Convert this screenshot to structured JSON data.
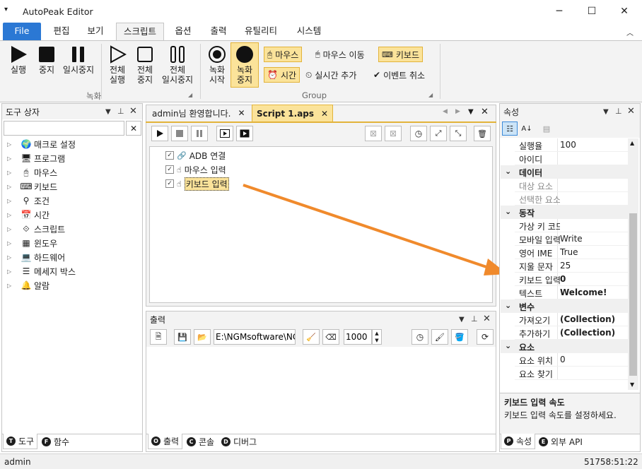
{
  "window": {
    "title": "AutoPeak Editor",
    "minimize_glyph": "─",
    "maximize_glyph": "☐",
    "close_glyph": "✕"
  },
  "ribbon_tabs": [
    "File",
    "편집",
    "보기",
    "스크립트",
    "옵션",
    "출력",
    "유틸리티",
    "시스템"
  ],
  "ribbon": {
    "record_group": {
      "label": "녹화",
      "run": "실행",
      "stop": "중지",
      "pause": "일시중지",
      "run_all_1": "전체",
      "run_all_2": "실행",
      "stop_all_1": "전체",
      "stop_all_2": "중지",
      "pause_all_1": "전체",
      "pause_all_2": "일시중지"
    },
    "group": {
      "label": "Group",
      "rec_start_1": "녹화",
      "rec_start_2": "시작",
      "rec_stop_1": "녹화",
      "rec_stop_2": "중지",
      "mouse": "마우스",
      "mouse_move": "마우스 이동",
      "keyboard": "키보드",
      "time": "시간",
      "add_realtime": "실시간 추가",
      "cancel_event": "이벤트 취소"
    }
  },
  "toolbox": {
    "title": "도구 상자",
    "search_value": "",
    "items": [
      "매크로 설정",
      "프로그램",
      "마우스",
      "키보드",
      "조건",
      "시간",
      "스크립트",
      "윈도우",
      "하드웨어",
      "메세지 박스",
      "알람"
    ],
    "tabs": [
      {
        "badge": "T",
        "label": "도구"
      },
      {
        "badge": "F",
        "label": "함수"
      }
    ]
  },
  "documents": {
    "tabs": [
      {
        "label": "admin님 환영합니다."
      },
      {
        "label": "Script 1.aps"
      }
    ],
    "script_items": [
      {
        "label": "ADB 연결",
        "checked": true
      },
      {
        "label": "마우스 입력",
        "checked": true
      },
      {
        "label": "키보드 입력",
        "checked": true,
        "selected": true
      }
    ]
  },
  "output": {
    "title": "출력",
    "path_value": "E:\\NGMsoftware\\NG",
    "number_value": "1000",
    "tabs": [
      {
        "badge": "O",
        "label": "출력"
      },
      {
        "badge": "C",
        "label": "콘솔"
      },
      {
        "badge": "D",
        "label": "디버그"
      }
    ]
  },
  "properties": {
    "title": "속성",
    "rows": [
      {
        "type": "prop",
        "key": "실행율",
        "value": "100"
      },
      {
        "type": "prop",
        "key": "아이디",
        "value": ""
      },
      {
        "type": "cat",
        "key": "데이터"
      },
      {
        "type": "prop",
        "key": "대상 요소",
        "value": "",
        "disabled": true
      },
      {
        "type": "prop",
        "key": "선택한 요소",
        "value": "",
        "disabled": true
      },
      {
        "type": "cat",
        "key": "동작"
      },
      {
        "type": "prop",
        "key": "가상 키 코드",
        "value": ""
      },
      {
        "type": "prop",
        "key": "모바일 입력",
        "value": "Write"
      },
      {
        "type": "prop",
        "key": "영어 IME",
        "value": "True"
      },
      {
        "type": "prop",
        "key": "지울 문자",
        "value": "25"
      },
      {
        "type": "prop",
        "key": "키보드 입력 속도",
        "value": "0",
        "bold": true
      },
      {
        "type": "prop",
        "key": "텍스트",
        "value": "Welcome!",
        "bold": true
      },
      {
        "type": "cat",
        "key": "변수"
      },
      {
        "type": "prop",
        "key": "가져오기",
        "value": "(Collection)",
        "bold": true
      },
      {
        "type": "prop",
        "key": "추가하기",
        "value": "(Collection)",
        "bold": true
      },
      {
        "type": "cat",
        "key": "요소"
      },
      {
        "type": "prop",
        "key": "요소 위치",
        "value": "0"
      },
      {
        "type": "prop",
        "key": "요소 찾기",
        "value": ""
      }
    ],
    "desc_title": "키보드 입력 속도",
    "desc_text": "키보드 입력 속도를 설정하세요.",
    "tabs": [
      {
        "badge": "P",
        "label": "속성"
      },
      {
        "badge": "E",
        "label": "외부 API"
      }
    ]
  },
  "status": {
    "user": "admin",
    "time": "51758:51:22"
  },
  "colors": {
    "accent": "#2b78d4",
    "highlight": "#fbe39a",
    "highlight_border": "#e2b33a",
    "arrow": "#f08a2c"
  }
}
